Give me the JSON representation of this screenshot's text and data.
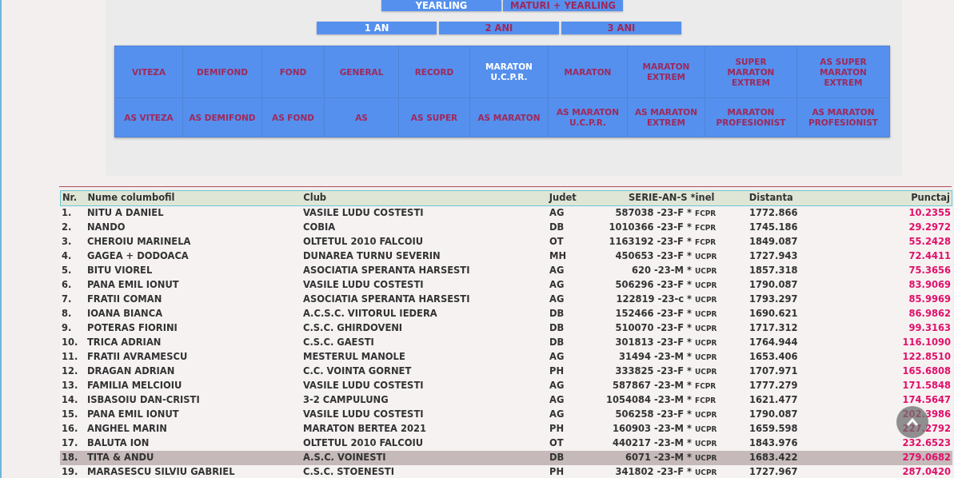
{
  "type_tabs": [
    {
      "label": "YEARLING",
      "selected": true
    },
    {
      "label": "MATURI + YEARLING",
      "selected": false
    }
  ],
  "age_tabs": [
    {
      "label": "1 AN",
      "selected": true
    },
    {
      "label": "2 ANI",
      "selected": false
    },
    {
      "label": "3 ANI",
      "selected": false
    }
  ],
  "categories": [
    [
      {
        "label": "VITEZA",
        "selected": false
      },
      {
        "label": "DEMIFOND",
        "selected": false
      },
      {
        "label": "FOND",
        "selected": false
      },
      {
        "label": "GENERAL",
        "selected": false
      },
      {
        "label": "RECORD",
        "selected": false
      },
      {
        "label": "MARATON\nU.C.P.R.",
        "selected": true
      },
      {
        "label": "MARATON",
        "selected": false
      },
      {
        "label": "MARATON\nEXTREM",
        "selected": false
      },
      {
        "label": "SUPER\nMARATON\nEXTREM",
        "selected": false
      },
      {
        "label": "AS SUPER\nMARATON\nEXTREM",
        "selected": false
      }
    ],
    [
      {
        "label": "AS VITEZA",
        "selected": false
      },
      {
        "label": "AS DEMIFOND",
        "selected": false
      },
      {
        "label": "AS FOND",
        "selected": false
      },
      {
        "label": "AS",
        "selected": false
      },
      {
        "label": "AS SUPER",
        "selected": false
      },
      {
        "label": "AS MARATON",
        "selected": false
      },
      {
        "label": "AS MARATON\nU.C.P.R.",
        "selected": false
      },
      {
        "label": "AS MARATON\nEXTREM",
        "selected": false
      },
      {
        "label": "MARATON\nPROFESIONIST",
        "selected": false
      },
      {
        "label": "AS MARATON\nPROFESIONIST",
        "selected": false
      }
    ]
  ],
  "table": {
    "columns": [
      "Nr.",
      "Nume columbofil",
      "Club",
      "Judet",
      "SERIE-AN-S *inel",
      "Distanta",
      "Punctaj"
    ],
    "rows": [
      {
        "nr": "1.",
        "name": "NITU A DANIEL",
        "club": "VASILE LUDU COSTESTI",
        "judet": "AG",
        "serie": "587038 -23-F *",
        "union": "FCPR",
        "distanta": "1772.866",
        "punctaj": "10.2355",
        "selected": false
      },
      {
        "nr": "2.",
        "name": "NANDO",
        "club": "COBIA",
        "judet": "DB",
        "serie": "1010366 -23-F *",
        "union": "FCPR",
        "distanta": "1745.186",
        "punctaj": "29.2972",
        "selected": false
      },
      {
        "nr": "3.",
        "name": "CHEROIU MARINELA",
        "club": "OLTETUL 2010 FALCOIU",
        "judet": "OT",
        "serie": "1163192 -23-F *",
        "union": "FCPR",
        "distanta": "1849.087",
        "punctaj": "55.2428",
        "selected": false
      },
      {
        "nr": "4.",
        "name": "GAGEA + DODOACA",
        "club": "DUNAREA TURNU SEVERIN",
        "judet": "MH",
        "serie": "450653 -23-F *",
        "union": "UCPR",
        "distanta": "1727.943",
        "punctaj": "72.4411",
        "selected": false
      },
      {
        "nr": "5.",
        "name": "BITU VIOREL",
        "club": "ASOCIATIA SPERANTA HARSESTI",
        "judet": "AG",
        "serie": "620 -23-M *",
        "union": "UCPR",
        "distanta": "1857.318",
        "punctaj": "75.3656",
        "selected": false
      },
      {
        "nr": "6.",
        "name": "PANA EMIL IONUT",
        "club": "VASILE LUDU COSTESTI",
        "judet": "AG",
        "serie": "506296 -23-F *",
        "union": "UCPR",
        "distanta": "1790.087",
        "punctaj": "83.9069",
        "selected": false
      },
      {
        "nr": "7.",
        "name": "FRATII COMAN",
        "club": "ASOCIATIA SPERANTA HARSESTI",
        "judet": "AG",
        "serie": "122819 -23-c *",
        "union": "UCPR",
        "distanta": "1793.297",
        "punctaj": "85.9969",
        "selected": false
      },
      {
        "nr": "8.",
        "name": "IOANA BIANCA",
        "club": "A.C.S.C. VIITORUL IEDERA",
        "judet": "DB",
        "serie": "152466 -23-F *",
        "union": "UCPR",
        "distanta": "1690.621",
        "punctaj": "86.9862",
        "selected": false
      },
      {
        "nr": "9.",
        "name": "POTERAS FIORINI",
        "club": "C.S.C. GHIRDOVENI",
        "judet": "DB",
        "serie": "510070 -23-F *",
        "union": "UCPR",
        "distanta": "1717.312",
        "punctaj": "99.3163",
        "selected": false
      },
      {
        "nr": "10.",
        "name": "TRICA ADRIAN",
        "club": "C.S.C. GAESTI",
        "judet": "DB",
        "serie": "301813 -23-F *",
        "union": "UCPR",
        "distanta": "1764.944",
        "punctaj": "116.1090",
        "selected": false
      },
      {
        "nr": "11.",
        "name": "FRATII AVRAMESCU",
        "club": "MESTERUL MANOLE",
        "judet": "AG",
        "serie": "31494 -23-M *",
        "union": "UCPR",
        "distanta": "1653.406",
        "punctaj": "122.8510",
        "selected": false
      },
      {
        "nr": "12.",
        "name": "DRAGAN ADRIAN",
        "club": "C.C. VOINTA GORNET",
        "judet": "PH",
        "serie": "333825 -23-F *",
        "union": "UCPR",
        "distanta": "1707.971",
        "punctaj": "165.6808",
        "selected": false
      },
      {
        "nr": "13.",
        "name": "FAMILIA MELCIOIU",
        "club": "VASILE LUDU COSTESTI",
        "judet": "AG",
        "serie": "587867 -23-M *",
        "union": "FCPR",
        "distanta": "1777.279",
        "punctaj": "171.5848",
        "selected": false
      },
      {
        "nr": "14.",
        "name": "ISBASOIU DAN-CRISTI",
        "club": "3-2 CAMPULUNG",
        "judet": "AG",
        "serie": "1054084 -23-M *",
        "union": "FCPR",
        "distanta": "1621.477",
        "punctaj": "174.5647",
        "selected": false
      },
      {
        "nr": "15.",
        "name": "PANA EMIL IONUT",
        "club": "VASILE LUDU COSTESTI",
        "judet": "AG",
        "serie": "506258 -23-F *",
        "union": "UCPR",
        "distanta": "1790.087",
        "punctaj": "202.3986",
        "selected": false
      },
      {
        "nr": "16.",
        "name": "ANGHEL MARIN",
        "club": "MARATON BERTEA 2021",
        "judet": "PH",
        "serie": "160903 -23-M *",
        "union": "UCPR",
        "distanta": "1659.598",
        "punctaj": "227.2792",
        "selected": false
      },
      {
        "nr": "17.",
        "name": "BALUTA ION",
        "club": "OLTETUL 2010 FALCOIU",
        "judet": "OT",
        "serie": "440217 -23-M *",
        "union": "UCPR",
        "distanta": "1843.976",
        "punctaj": "232.6523",
        "selected": false
      },
      {
        "nr": "18.",
        "name": "TITA & ANDU",
        "club": "A.S.C. VOINESTI",
        "judet": "DB",
        "serie": "6071 -23-M *",
        "union": "UCPR",
        "distanta": "1683.422",
        "punctaj": "279.0682",
        "selected": true
      },
      {
        "nr": "19.",
        "name": "MARASESCU SILVIU GABRIEL",
        "club": "C.S.C. STOENESTI",
        "judet": "PH",
        "serie": "341802 -23-F *",
        "union": "UCPR",
        "distanta": "1727.967",
        "punctaj": "287.0420",
        "selected": false
      }
    ]
  }
}
